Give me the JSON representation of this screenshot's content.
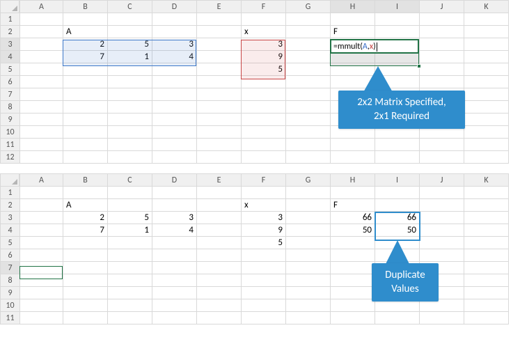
{
  "columns": [
    "A",
    "B",
    "C",
    "D",
    "E",
    "F",
    "G",
    "H",
    "I",
    "J",
    "K"
  ],
  "top": {
    "rows": 12,
    "labelA": "A",
    "labelX": "x",
    "labelF": "F",
    "matA_r1": [
      "2",
      "5",
      "3"
    ],
    "matA_r2": [
      "7",
      "1",
      "4"
    ],
    "matX": [
      "3",
      "9",
      "5"
    ],
    "formula_prefix": "=mmult(",
    "formula_argA": "A",
    "formula_sep": ",",
    "formula_argX": "x",
    "formula_suffix": ")",
    "callout_line1": "2x2 Matrix Specified,",
    "callout_line2": "2x1 Required"
  },
  "bottom": {
    "rows": 11,
    "labelA": "A",
    "labelX": "x",
    "labelF": "F",
    "matA_r1": [
      "2",
      "5",
      "3"
    ],
    "matA_r2": [
      "7",
      "1",
      "4"
    ],
    "matX": [
      "3",
      "9",
      "5"
    ],
    "resH": [
      "66",
      "50"
    ],
    "resI": [
      "66",
      "50"
    ],
    "callout_line1": "Duplicate",
    "callout_line2": "Values"
  }
}
